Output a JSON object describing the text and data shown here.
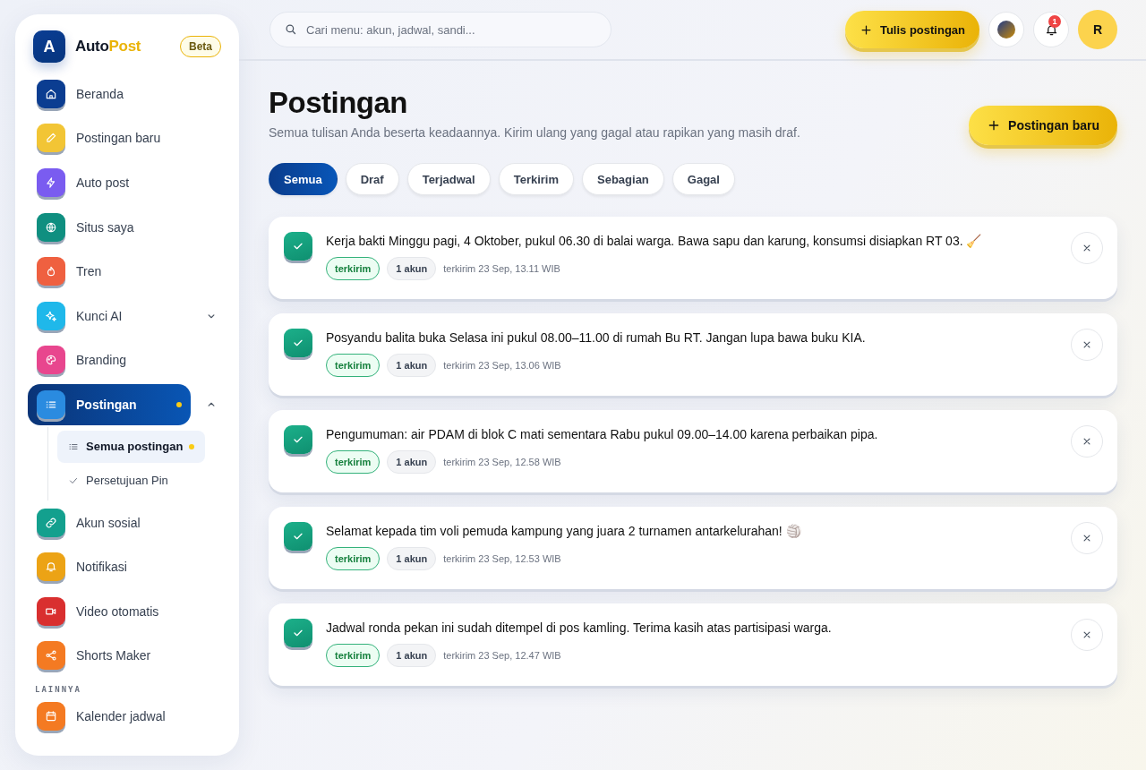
{
  "brand": {
    "letter": "A",
    "name_part1": "Auto",
    "name_part2": "Post",
    "badge": "Beta"
  },
  "sidebar": {
    "items": [
      {
        "label": "Beranda",
        "color": "#0b3d91",
        "selected": false
      },
      {
        "label": "Postingan baru",
        "color": "#f2c535",
        "selected": false
      },
      {
        "label": "Auto post",
        "color": "#7a5cf0",
        "selected": false
      },
      {
        "label": "Situs saya",
        "color": "#0f8f80",
        "selected": false
      },
      {
        "label": "Tren",
        "color": "#ef6040",
        "selected": false
      },
      {
        "label": "Kunci AI",
        "color": "#1fb8ea",
        "selected": false,
        "expanded": false
      },
      {
        "label": "Branding",
        "color": "#e8468e",
        "selected": false
      },
      {
        "label": "Postingan",
        "color": "#2a8be0",
        "selected": true,
        "dot": true,
        "expanded": true,
        "children": [
          {
            "label": "Semua postingan",
            "selected": true,
            "dot": true
          },
          {
            "label": "Persetujuan Pin",
            "selected": false,
            "dot": false
          }
        ]
      },
      {
        "label": "Akun sosial",
        "color": "#13a08e",
        "selected": false
      },
      {
        "label": "Notifikasi",
        "color": "#eca315",
        "selected": false
      },
      {
        "label": "Video otomatis",
        "color": "#d92f2f",
        "selected": false
      },
      {
        "label": "Shorts Maker",
        "color": "#f47a22",
        "selected": false
      }
    ],
    "section_label": "LAINNYA",
    "section_items": [
      {
        "label": "Kalender jadwal",
        "color": "#f47a22",
        "selected": false
      }
    ]
  },
  "topbar": {
    "search": {
      "placeholder": "Cari menu: akun, jadwal, sandi..."
    },
    "compose_button": "Tulis postingan",
    "notification_count": "1",
    "avatar": "R"
  },
  "page": {
    "title": "Postingan",
    "subtitle": "Semua tulisan Anda beserta keadaannya. Kirim ulang yang gagal atau rapikan yang masih draf.",
    "new_button": "Postingan baru"
  },
  "filters": [
    {
      "label": "Semua",
      "selected": true
    },
    {
      "label": "Draf",
      "selected": false
    },
    {
      "label": "Terjadwal",
      "selected": false
    },
    {
      "label": "Terkirim",
      "selected": false
    },
    {
      "label": "Sebagian",
      "selected": false
    },
    {
      "label": "Gagal",
      "selected": false
    }
  ],
  "posts": [
    {
      "text": "Kerja bakti Minggu pagi, 4 Oktober, pukul 06.30 di balai warga. Bawa sapu dan karung, konsumsi disiapkan RT 03. 🧹",
      "status": "terkirim",
      "kind": "sent",
      "accounts": "1 akun",
      "time": "terkirim 23 Sep, 13.11 WIB"
    },
    {
      "text": "Posyandu balita buka Selasa ini pukul 08.00–11.00 di rumah Bu RT. Jangan lupa bawa buku KIA.",
      "status": "terkirim",
      "kind": "sent",
      "accounts": "1 akun",
      "time": "terkirim 23 Sep, 13.06 WIB"
    },
    {
      "text": "Pengumuman: air PDAM di blok C mati sementara Rabu pukul 09.00–14.00 karena perbaikan pipa.",
      "status": "terkirim",
      "kind": "sent",
      "accounts": "1 akun",
      "time": "terkirim 23 Sep, 12.58 WIB"
    },
    {
      "text": "Selamat kepada tim voli pemuda kampung yang juara 2 turnamen antarkelurahan! 🏐",
      "status": "terkirim",
      "kind": "sent",
      "accounts": "1 akun",
      "time": "terkirim 23 Sep, 12.53 WIB"
    },
    {
      "text": "Jadwal ronda pekan ini sudah ditempel di pos kamling. Terima kasih atas partisipasi warga.",
      "status": "terkirim",
      "kind": "sent",
      "accounts": "1 akun",
      "time": "terkirim 23 Sep, 12.47 WIB"
    }
  ]
}
